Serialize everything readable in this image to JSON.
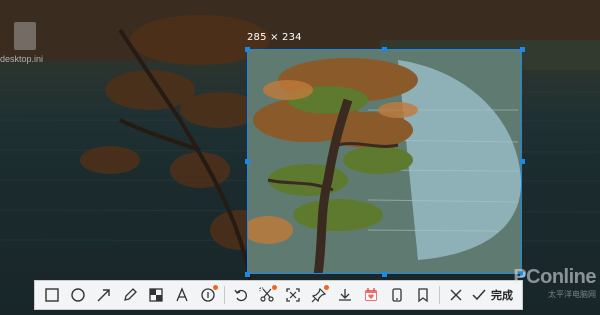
{
  "desktop": {
    "file_name": "desktop.ini"
  },
  "selection": {
    "size_label": "285 × 234"
  },
  "toolbar": {
    "tools": [
      {
        "name": "rectangle-tool",
        "icon": "rectangle-icon"
      },
      {
        "name": "ellipse-tool",
        "icon": "circle-icon"
      },
      {
        "name": "arrow-tool",
        "icon": "arrow-icon"
      },
      {
        "name": "pen-tool",
        "icon": "pencil-icon"
      },
      {
        "name": "mosaic-tool",
        "icon": "mosaic-icon"
      },
      {
        "name": "text-tool",
        "icon": "text-icon"
      },
      {
        "name": "number-tool",
        "icon": "number-icon"
      },
      {
        "name": "undo-tool",
        "icon": "undo-icon"
      },
      {
        "name": "cutout-tool",
        "icon": "scissors-icon"
      },
      {
        "name": "ocr-tool",
        "icon": "scan-icon"
      },
      {
        "name": "pin-tool",
        "icon": "pin-icon"
      },
      {
        "name": "save-tool",
        "icon": "download-icon"
      },
      {
        "name": "calendar-tool",
        "icon": "calendar-icon"
      },
      {
        "name": "phone-tool",
        "icon": "phone-icon"
      },
      {
        "name": "bookmark-tool",
        "icon": "bookmark-icon"
      },
      {
        "name": "cancel-tool",
        "icon": "close-icon"
      }
    ],
    "done_label": "完成",
    "accent": "#f26522"
  },
  "watermark": {
    "brand": "PConline",
    "sub": "太平洋电脑网"
  }
}
